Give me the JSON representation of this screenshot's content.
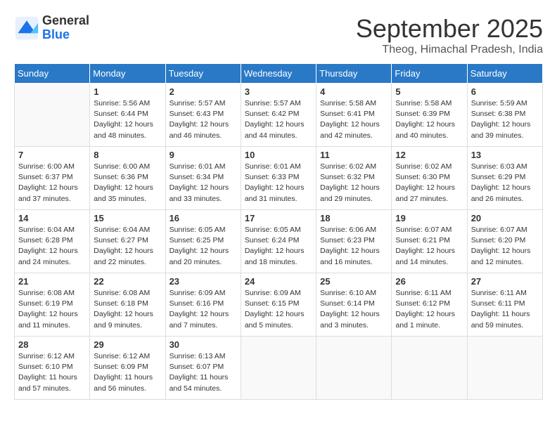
{
  "header": {
    "logo_general": "General",
    "logo_blue": "Blue",
    "month_title": "September 2025",
    "subtitle": "Theog, Himachal Pradesh, India"
  },
  "days_of_week": [
    "Sunday",
    "Monday",
    "Tuesday",
    "Wednesday",
    "Thursday",
    "Friday",
    "Saturday"
  ],
  "weeks": [
    [
      {
        "day": "",
        "info": ""
      },
      {
        "day": "1",
        "info": "Sunrise: 5:56 AM\nSunset: 6:44 PM\nDaylight: 12 hours\nand 48 minutes."
      },
      {
        "day": "2",
        "info": "Sunrise: 5:57 AM\nSunset: 6:43 PM\nDaylight: 12 hours\nand 46 minutes."
      },
      {
        "day": "3",
        "info": "Sunrise: 5:57 AM\nSunset: 6:42 PM\nDaylight: 12 hours\nand 44 minutes."
      },
      {
        "day": "4",
        "info": "Sunrise: 5:58 AM\nSunset: 6:41 PM\nDaylight: 12 hours\nand 42 minutes."
      },
      {
        "day": "5",
        "info": "Sunrise: 5:58 AM\nSunset: 6:39 PM\nDaylight: 12 hours\nand 40 minutes."
      },
      {
        "day": "6",
        "info": "Sunrise: 5:59 AM\nSunset: 6:38 PM\nDaylight: 12 hours\nand 39 minutes."
      }
    ],
    [
      {
        "day": "7",
        "info": "Sunrise: 6:00 AM\nSunset: 6:37 PM\nDaylight: 12 hours\nand 37 minutes."
      },
      {
        "day": "8",
        "info": "Sunrise: 6:00 AM\nSunset: 6:36 PM\nDaylight: 12 hours\nand 35 minutes."
      },
      {
        "day": "9",
        "info": "Sunrise: 6:01 AM\nSunset: 6:34 PM\nDaylight: 12 hours\nand 33 minutes."
      },
      {
        "day": "10",
        "info": "Sunrise: 6:01 AM\nSunset: 6:33 PM\nDaylight: 12 hours\nand 31 minutes."
      },
      {
        "day": "11",
        "info": "Sunrise: 6:02 AM\nSunset: 6:32 PM\nDaylight: 12 hours\nand 29 minutes."
      },
      {
        "day": "12",
        "info": "Sunrise: 6:02 AM\nSunset: 6:30 PM\nDaylight: 12 hours\nand 27 minutes."
      },
      {
        "day": "13",
        "info": "Sunrise: 6:03 AM\nSunset: 6:29 PM\nDaylight: 12 hours\nand 26 minutes."
      }
    ],
    [
      {
        "day": "14",
        "info": "Sunrise: 6:04 AM\nSunset: 6:28 PM\nDaylight: 12 hours\nand 24 minutes."
      },
      {
        "day": "15",
        "info": "Sunrise: 6:04 AM\nSunset: 6:27 PM\nDaylight: 12 hours\nand 22 minutes."
      },
      {
        "day": "16",
        "info": "Sunrise: 6:05 AM\nSunset: 6:25 PM\nDaylight: 12 hours\nand 20 minutes."
      },
      {
        "day": "17",
        "info": "Sunrise: 6:05 AM\nSunset: 6:24 PM\nDaylight: 12 hours\nand 18 minutes."
      },
      {
        "day": "18",
        "info": "Sunrise: 6:06 AM\nSunset: 6:23 PM\nDaylight: 12 hours\nand 16 minutes."
      },
      {
        "day": "19",
        "info": "Sunrise: 6:07 AM\nSunset: 6:21 PM\nDaylight: 12 hours\nand 14 minutes."
      },
      {
        "day": "20",
        "info": "Sunrise: 6:07 AM\nSunset: 6:20 PM\nDaylight: 12 hours\nand 12 minutes."
      }
    ],
    [
      {
        "day": "21",
        "info": "Sunrise: 6:08 AM\nSunset: 6:19 PM\nDaylight: 12 hours\nand 11 minutes."
      },
      {
        "day": "22",
        "info": "Sunrise: 6:08 AM\nSunset: 6:18 PM\nDaylight: 12 hours\nand 9 minutes."
      },
      {
        "day": "23",
        "info": "Sunrise: 6:09 AM\nSunset: 6:16 PM\nDaylight: 12 hours\nand 7 minutes."
      },
      {
        "day": "24",
        "info": "Sunrise: 6:09 AM\nSunset: 6:15 PM\nDaylight: 12 hours\nand 5 minutes."
      },
      {
        "day": "25",
        "info": "Sunrise: 6:10 AM\nSunset: 6:14 PM\nDaylight: 12 hours\nand 3 minutes."
      },
      {
        "day": "26",
        "info": "Sunrise: 6:11 AM\nSunset: 6:12 PM\nDaylight: 12 hours\nand 1 minute."
      },
      {
        "day": "27",
        "info": "Sunrise: 6:11 AM\nSunset: 6:11 PM\nDaylight: 11 hours\nand 59 minutes."
      }
    ],
    [
      {
        "day": "28",
        "info": "Sunrise: 6:12 AM\nSunset: 6:10 PM\nDaylight: 11 hours\nand 57 minutes."
      },
      {
        "day": "29",
        "info": "Sunrise: 6:12 AM\nSunset: 6:09 PM\nDaylight: 11 hours\nand 56 minutes."
      },
      {
        "day": "30",
        "info": "Sunrise: 6:13 AM\nSunset: 6:07 PM\nDaylight: 11 hours\nand 54 minutes."
      },
      {
        "day": "",
        "info": ""
      },
      {
        "day": "",
        "info": ""
      },
      {
        "day": "",
        "info": ""
      },
      {
        "day": "",
        "info": ""
      }
    ]
  ]
}
